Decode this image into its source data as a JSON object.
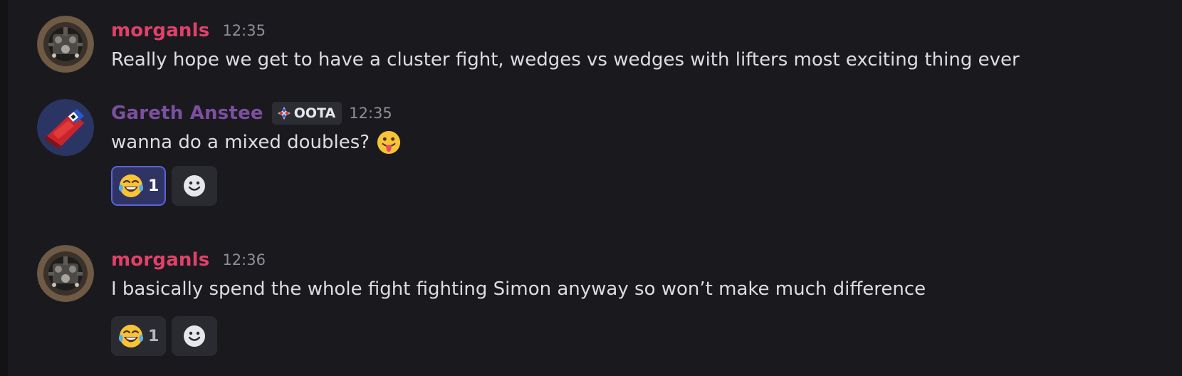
{
  "messages": [
    {
      "username": "morganls",
      "timestamp": "12:35",
      "content": "Really hope we get to have a cluster fight, wedges vs wedges with lifters most exciting thing ever",
      "avatar_icon": "robot-avatar-icon"
    },
    {
      "username": "Gareth Anstee",
      "tag": {
        "label": "OOTA",
        "icon": "oota-tag-icon"
      },
      "timestamp": "12:35",
      "content": "wanna do a mixed doubles?",
      "inline_emoji": "tongue-out-emoji",
      "avatar_icon": "red-robot-avatar-icon",
      "reactions": [
        {
          "emoji": "tears-of-joy-emoji",
          "count": "1",
          "active": true
        }
      ]
    },
    {
      "username": "morganls",
      "timestamp": "12:36",
      "content": "I basically spend the whole fight fighting Simon anyway so won’t make much difference",
      "avatar_icon": "robot-avatar-icon",
      "reactions": [
        {
          "emoji": "tears-of-joy-emoji",
          "count": "1",
          "active": false
        }
      ]
    }
  ],
  "colors": {
    "background": "#1a1a1e",
    "username_pink": "#e0416a",
    "username_purple": "#7c4fa0",
    "reaction_active_bg": "#2f3464",
    "reaction_active_border": "#5a64d8"
  },
  "icons": {
    "add_reaction": "smiley-add-reaction-icon"
  }
}
